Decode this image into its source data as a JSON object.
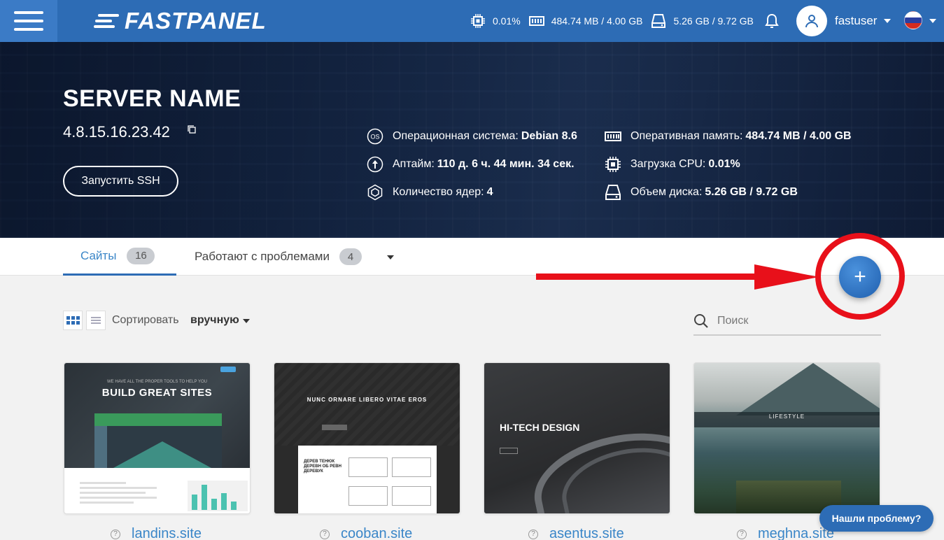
{
  "topbar": {
    "logo_text": "FASTPANEL",
    "cpu": "0.01%",
    "ram": "484.74 MB / 4.00 GB",
    "disk": "5.26 GB / 9.72 GB",
    "username": "fastuser",
    "brand_color": "#2d6cb5"
  },
  "server": {
    "name": "SERVER NAME",
    "ip": "4.8.15.16.23.42",
    "ssh_button": "Запустить SSH",
    "info_left": [
      {
        "label": "Операционная система:",
        "value": "Debian 8.6",
        "icon": "os-icon"
      },
      {
        "label": "Аптайм:",
        "value": "110 д. 6 ч. 44 мин. 34 сек.",
        "icon": "uptime-icon"
      },
      {
        "label": "Количество ядер:",
        "value": "4",
        "icon": "cores-icon"
      }
    ],
    "info_right": [
      {
        "label": "Оперативная память:",
        "value": "484.74 MB / 4.00 GB",
        "icon": "ram-icon"
      },
      {
        "label": "Загрузка CPU:",
        "value": "0.01%",
        "icon": "cpu-icon"
      },
      {
        "label": "Объем диска:",
        "value": "5.26 GB / 9.72 GB",
        "icon": "disk-icon"
      }
    ]
  },
  "tabs": [
    {
      "label": "Сайты",
      "count": "16",
      "active": true
    },
    {
      "label": "Работают с проблемами",
      "count": "4",
      "active": false
    }
  ],
  "add_button": {
    "label": "+"
  },
  "toolbar": {
    "sort_label": "Сортировать",
    "sort_value": "вручную",
    "search_placeholder": "Поиск"
  },
  "sites": [
    {
      "name": "landins.site",
      "preview_title": "BUILD GREAT SITES",
      "preview_subtitle": "WE HAVE ALL THE PROPER TOOLS TO HELP YOU"
    },
    {
      "name": "cooban.site",
      "preview_title": "NUNC ORNARE LIBERO VITAE EROS",
      "preview_heading": "ДЕРЕВ ТЕНЮК ДЕРЕВН ОБ РЕВН ДЕРЕВУК"
    },
    {
      "name": "asentus.site",
      "preview_title": "HI-TECH DESIGN"
    },
    {
      "name": "meghna.site",
      "preview_title": "LIFESTYLE"
    }
  ],
  "help_button": "Нашли проблему?",
  "accent_red": "#e8101a"
}
